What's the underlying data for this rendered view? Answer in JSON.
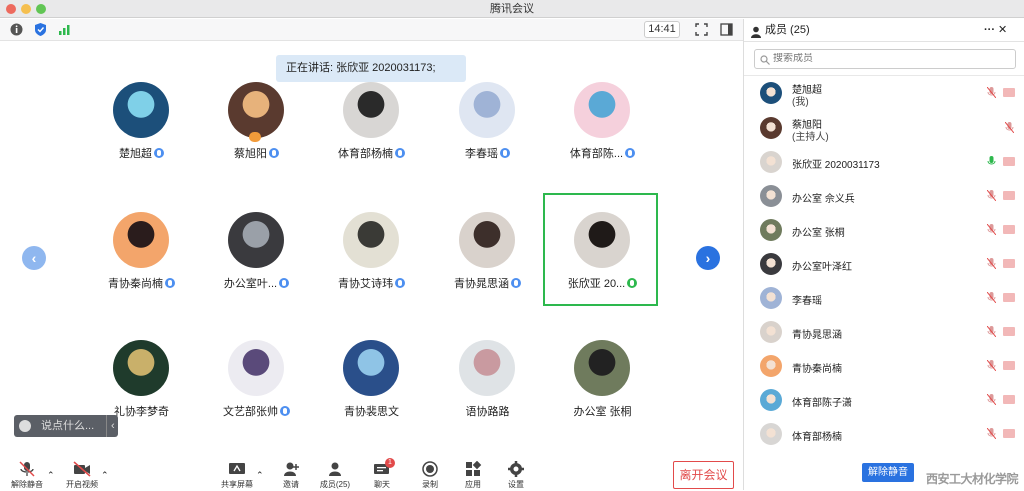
{
  "window": {
    "title": "腾讯会议",
    "clock": "14:41"
  },
  "speaking": {
    "text": "正在讲话: 张欣亚 2020031173;"
  },
  "tiles": [
    {
      "name": "楚旭超",
      "mic": "blue",
      "color": "#1c4f7a",
      "accent": "#7fd0e8"
    },
    {
      "name": "蔡旭阳",
      "mic": "blue",
      "color": "#5a3a2f",
      "accent": "#e7b27b",
      "host": true
    },
    {
      "name": "体育部杨楠",
      "mic": "blue",
      "color": "#d8d6d4",
      "accent": "#2a2a2a"
    },
    {
      "name": "李春瑶",
      "mic": "blue",
      "color": "#dfe6f2",
      "accent": "#9fb3d6"
    },
    {
      "name": "体育部陈...",
      "mic": "blue",
      "color": "#f5d0dc",
      "accent": "#5aa9d6"
    },
    {
      "name": "青协秦尚楠",
      "mic": "blue",
      "color": "#f3a56b",
      "accent": "#2a1c1c"
    },
    {
      "name": "办公室叶...",
      "mic": "blue",
      "color": "#3a3a3e",
      "accent": "#9aa0a8"
    },
    {
      "name": "青协艾诗玮",
      "mic": "blue",
      "color": "#e3e0d4",
      "accent": "#3a3a36"
    },
    {
      "name": "青协晁思涵",
      "mic": "blue",
      "color": "#d9d2cc",
      "accent": "#3d2f2b"
    },
    {
      "name": "张欣亚 20...",
      "mic": "green",
      "color": "#d9d4cf",
      "accent": "#1f1a18"
    },
    {
      "name": "礼协李梦奇",
      "mic": "none",
      "color": "#1f3b2c",
      "accent": "#c9b06a"
    },
    {
      "name": "文艺部张帅",
      "mic": "blue",
      "color": "#ecebf1",
      "accent": "#5a4a7a"
    },
    {
      "name": "青协裴思文",
      "mic": "none",
      "color": "#2a4f8a",
      "accent": "#8fc4e6"
    },
    {
      "name": "语协路路",
      "mic": "none",
      "color": "#dfe3e6",
      "accent": "#c99aa0"
    },
    {
      "name": "办公室 张桐",
      "mic": "none",
      "color": "#6f7b5d",
      "accent": "#222"
    }
  ],
  "chat": {
    "placeholder": "说点什么...",
    "arrow": "‹"
  },
  "nav": {
    "prev": "‹",
    "next": "›"
  },
  "bottombar": {
    "unmute": "解除静音",
    "video": "开启视频",
    "share": "共享屏幕",
    "invite": "邀请",
    "members": "成员(25)",
    "chat": "聊天",
    "chat_badge": "1",
    "record": "录制",
    "apps": "应用",
    "settings": "设置",
    "leave": "离开会议"
  },
  "panel": {
    "title": "成员 (25)",
    "more": "···",
    "close": "✕",
    "search_placeholder": "搜索成员",
    "unmute_all": "解除静音",
    "members": [
      {
        "name": "楚旭超",
        "role": "(我)",
        "mic": "muted",
        "cam": true,
        "color": "#1c4f7a"
      },
      {
        "name": "蔡旭阳",
        "role": "(主持人)",
        "mic": "muted",
        "cam": false,
        "color": "#5a3a2f"
      },
      {
        "name": "张欣亚 2020031173",
        "role": "",
        "mic": "active",
        "cam": true,
        "color": "#d9d4cf"
      },
      {
        "name": "办公室 佘义兵",
        "role": "",
        "mic": "muted",
        "cam": true,
        "color": "#8a8f96"
      },
      {
        "name": "办公室 张桐",
        "role": "",
        "mic": "muted",
        "cam": true,
        "color": "#6f7b5d"
      },
      {
        "name": "办公室叶泽红",
        "role": "",
        "mic": "muted",
        "cam": true,
        "color": "#3a3a3e"
      },
      {
        "name": "李春瑶",
        "role": "",
        "mic": "muted",
        "cam": true,
        "color": "#9fb3d6"
      },
      {
        "name": "青协晁思涵",
        "role": "",
        "mic": "muted",
        "cam": true,
        "color": "#d9d2cc"
      },
      {
        "name": "青协秦尚楠",
        "role": "",
        "mic": "muted",
        "cam": true,
        "color": "#f3a56b"
      },
      {
        "name": "体育部陈子潇",
        "role": "",
        "mic": "muted",
        "cam": true,
        "color": "#5aa9d6"
      },
      {
        "name": "体育部杨楠",
        "role": "",
        "mic": "muted",
        "cam": true,
        "color": "#d8d6d4"
      }
    ]
  },
  "watermark": "西安工大材化学院"
}
